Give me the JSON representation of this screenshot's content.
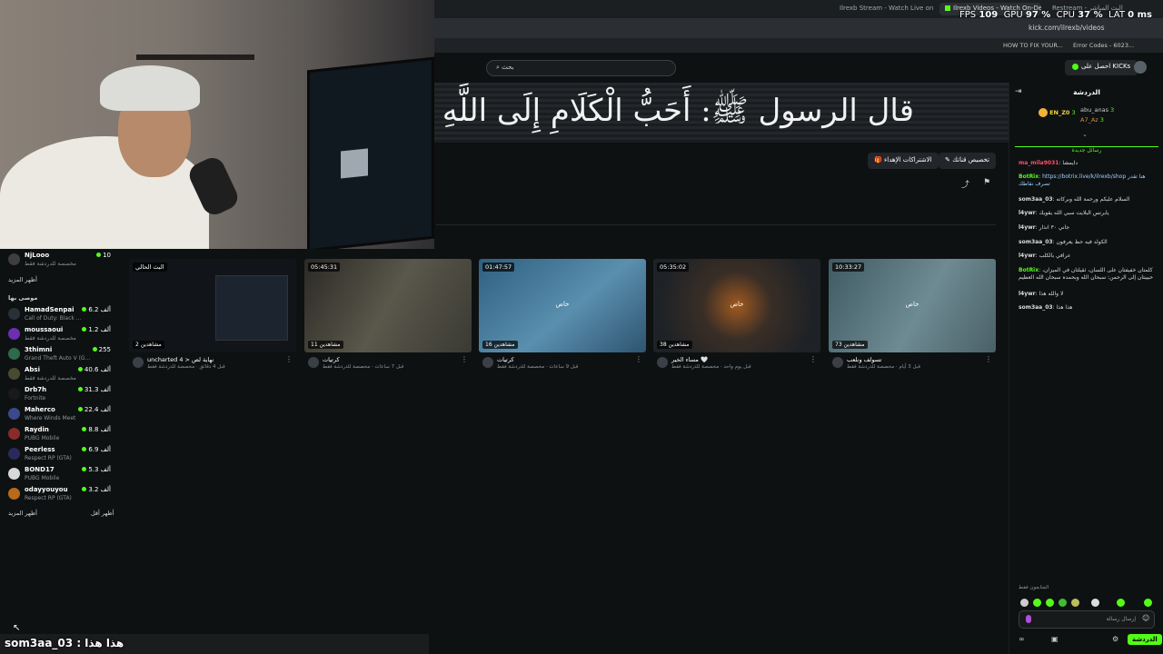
{
  "browser": {
    "tabs": [
      {
        "label": "Ilrexb Stream - Watch Live on Kick"
      },
      {
        "label": "Ilrexb Videos - Watch On-Demand"
      },
      {
        "label": "Restream - البث المباشر"
      }
    ],
    "url": "kick.com/ilrexb/videos",
    "bookmarks": [
      "HOW TO FIX YOUR...",
      "Error Codes - 6023..."
    ]
  },
  "perf": {
    "fps_label": "FPS",
    "fps": "109",
    "gpu_label": "GPU",
    "gpu": "97 %",
    "cpu_label": "CPU",
    "cpu": "37 %",
    "lat_label": "LAT",
    "lat": "0 ms"
  },
  "topnav": {
    "search_placeholder": "بحث",
    "get_kicks": "احصل على KICKs"
  },
  "banner": {
    "text": "قال الرسول ﷺ: أَحَبُّ الْكَلَامِ إِلَى اللَّهِ سُ"
  },
  "channel_actions": {
    "customize": "تخصيص قناتك",
    "gift_subs": "الاشتراكات الإهداء"
  },
  "sidebar": {
    "top_item": {
      "name": "NjLooo",
      "category": "مخصصة للدردشة فقط",
      "viewers": "10"
    },
    "show_more_1": "أظهر المزيد",
    "recommended_heading": "موصى بها",
    "items": [
      {
        "name": "HamadSenpai",
        "category": "Call of Duty: Black ...",
        "viewers": "6.2 ألف"
      },
      {
        "name": "moussaoui",
        "category": "مخصصة للدردشة فقط",
        "viewers": "1.2 ألف"
      },
      {
        "name": "3thimni",
        "category": "Grand Theft Auto V (G...",
        "viewers": "255"
      },
      {
        "name": "Absi",
        "category": "مخصصة للدردشة فقط",
        "viewers": "40.6 ألف"
      },
      {
        "name": "Drb7h",
        "category": "Fortnite",
        "viewers": "31.3 ألف"
      },
      {
        "name": "Maherco",
        "category": "Where Winds Meet",
        "viewers": "22.4 ألف"
      },
      {
        "name": "Raydin",
        "category": "PUBG Mobile",
        "viewers": "8.8 ألف"
      },
      {
        "name": "Peerless",
        "category": "Respect RP (GTA)",
        "viewers": "6.9 ألف"
      },
      {
        "name": "BOND17",
        "category": "PUBG Mobile",
        "viewers": "5.3 ألف"
      },
      {
        "name": "odayyouyou",
        "category": "Respect RP (GTA)",
        "viewers": "3.2 ألف"
      }
    ],
    "show_more_2": "أظهر المزيد",
    "show_less": "أظهر أقل"
  },
  "videos": [
    {
      "duration": "البث الحالي",
      "views": "2 مشاهدين",
      "sub": "",
      "title": "uncharted 4 > نهاية لص",
      "meta": "قبل 4 دقائق · مخصصة للدردشة فقط",
      "color": "#111418"
    },
    {
      "duration": "05:45:31",
      "views": "11 مشاهدين",
      "sub": "",
      "title": "كرتيات",
      "meta": "قبل 7 ساعات · مخصصة للدردشة فقط",
      "color": "#4b4a40"
    },
    {
      "duration": "01:47:57",
      "views": "16 مشاهدين",
      "sub": "خاص",
      "title": "كرتيات",
      "meta": "قبل 9 ساعات · مخصصة للدردشة فقط",
      "color": "#3f6f8f"
    },
    {
      "duration": "05:35:02",
      "views": "38 مشاهدين",
      "sub": "خاص",
      "title": "مساء الخير 🤍",
      "meta": "قبل يوم واحد · مخصصة للدردشة فقط",
      "color": "#3a2e26"
    },
    {
      "duration": "10:33:27",
      "views": "73 مشاهدين",
      "sub": "خاص",
      "title": "تسولف ونلعب",
      "meta": "قبل 3 أيام · مخصصة للدردشة فقط",
      "color": "#56717a"
    }
  ],
  "chat": {
    "title": "الدردشة",
    "gifters": [
      {
        "name": "EN_Z0",
        "count": "3"
      },
      {
        "name": "abu_anas",
        "count": "3"
      },
      {
        "name": "A7_Az",
        "count": "3"
      }
    ],
    "new_messages": "رسائل جديدة",
    "messages": [
      {
        "user": "ma_mila9031",
        "text": "دايمشا",
        "color": "#ff4d6a"
      },
      {
        "user": "BotRix",
        "text": "https://botrix.live/k/ilrexb/shop هنا تقدر تصرف نقاطك",
        "color": "#53fc18"
      },
      {
        "user": "som3aa_03",
        "text": "السلام عليكم ورحمة الله وبركاته",
        "color": "#ffffff"
      },
      {
        "user": "l4ywr",
        "text": "يابرنس البلايت سبي الله يقويك",
        "color": "#ffffff"
      },
      {
        "user": "l4ywr",
        "text": "جاني ٣٠ انذار",
        "color": "#ffffff"
      },
      {
        "user": "som3aa_03",
        "text": "الكولد فيه حظ يعرفون",
        "color": "#ffffff"
      },
      {
        "user": "l4ywr",
        "text": "عرافي بالكلب",
        "color": "#ffffff"
      },
      {
        "user": "BotRix",
        "text": "كلمتان خفيفتان على اللسان، ثقيلتان في الميزان، حبيبتان إلى الرحمن: سبحان الله وبحمده سبحان الله العظيم",
        "color": "#53fc18"
      },
      {
        "user": "l4ywr",
        "text": "لا والله هذا",
        "color": "#ffffff"
      },
      {
        "user": "som3aa_03",
        "text": "هذا هذا",
        "color": "#ffffff"
      }
    ],
    "emote_label": "المتابعون فقط",
    "input_placeholder": "إرسال رسالة",
    "send_label": "الدردشة"
  },
  "overlay": {
    "message": "som3aa_03 : هذا هذا"
  }
}
